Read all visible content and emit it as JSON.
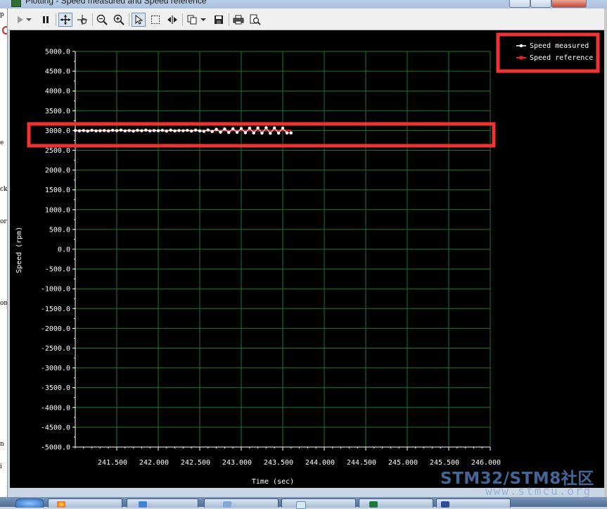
{
  "window": {
    "title": "Plotting  - Speed measured and Speed reference"
  },
  "left_panel": {
    "fragments": [
      "p",
      "e",
      "ck",
      "or",
      "om",
      "n",
      "i"
    ]
  },
  "toolbar": {
    "buttons": [
      "play-icon",
      "dropdown-icon",
      "pause-icon",
      "pan-icon",
      "auto-scale-icon",
      "zoom-out-icon",
      "zoom-in-icon",
      "select-pointer-icon",
      "select-rectangle-icon",
      "fit-horizontal-icon",
      "copy-icon",
      "dropdown-icon",
      "save-icon",
      "print-icon",
      "print-preview-icon"
    ]
  },
  "chart_data": {
    "type": "line",
    "title": "",
    "xlabel": "Time (sec)",
    "ylabel": "Speed (rpm)",
    "xlim": [
      241.0,
      246.0
    ],
    "ylim": [
      -5000,
      5000
    ],
    "x_ticks": [
      "241.500",
      "242.000",
      "242.500",
      "243.000",
      "243.500",
      "244.000",
      "244.500",
      "245.000",
      "245.500",
      "246.000"
    ],
    "y_ticks": [
      "5000.0",
      "4500.0",
      "4000.0",
      "3500.0",
      "3000.0",
      "2500.0",
      "2000.0",
      "1500.0",
      "1000.0",
      "500.0",
      "0.0",
      "-500.0",
      "-1000.0",
      "-1500.0",
      "-2000.0",
      "-2500.0",
      "-3000.0",
      "-3500.0",
      "-4000.0",
      "-4500.0",
      "-5000.0"
    ],
    "grid": true,
    "grid_color": "#1f7a1f",
    "background": "#000000",
    "legend_position": "top-right",
    "series": [
      {
        "name": "Speed measured",
        "color": "#ffffff",
        "x": [
          241.0,
          241.05,
          241.1,
          241.15,
          241.2,
          241.25,
          241.3,
          241.35,
          241.4,
          241.45,
          241.5,
          241.55,
          241.6,
          241.65,
          241.7,
          241.75,
          241.8,
          241.85,
          241.9,
          241.95,
          242.0,
          242.05,
          242.1,
          242.15,
          242.2,
          242.25,
          242.3,
          242.35,
          242.4,
          242.45,
          242.5,
          242.55,
          242.6,
          242.65,
          242.7,
          242.75,
          242.8,
          242.85,
          242.9,
          242.95,
          243.0,
          243.05,
          243.1,
          243.15,
          243.2,
          243.25,
          243.3,
          243.35,
          243.4,
          243.45,
          243.5,
          243.55,
          243.6
        ],
        "y": [
          3000,
          2990,
          3000,
          2985,
          3005,
          2990,
          2995,
          3000,
          2990,
          3005,
          2995,
          3010,
          2990,
          3000,
          2985,
          3005,
          2995,
          3010,
          2990,
          3000,
          2995,
          3005,
          2985,
          3010,
          2990,
          3000,
          2995,
          3005,
          2985,
          3010,
          2990,
          2980,
          3015,
          2975,
          3030,
          2960,
          3040,
          2950,
          3045,
          2955,
          3050,
          2945,
          3060,
          2940,
          3065,
          2935,
          3070,
          2930,
          3065,
          2935,
          3060,
          2940,
          2940
        ]
      },
      {
        "name": "Speed reference",
        "color": "#e32222",
        "x": [
          241.0,
          243.6
        ],
        "y": [
          3000,
          3000
        ]
      }
    ]
  },
  "highlights": {
    "color": "#ee3333"
  },
  "taskbar": {
    "items": [
      "start-orb-icon",
      "browser-icon",
      "settings-app-icon",
      "media-icon",
      "box-app-icon",
      "excel-icon",
      "explorer-icon"
    ]
  },
  "watermark": {
    "text": "STM32/STM8社区",
    "subtext": "www.stmcu.org"
  }
}
